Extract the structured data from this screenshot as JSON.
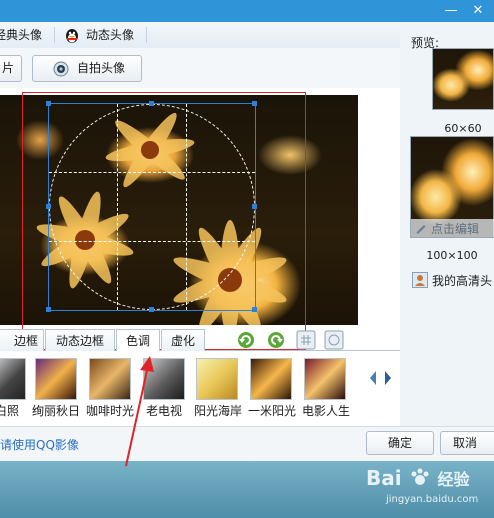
{
  "window": {
    "minimize": "—",
    "close": "✕"
  },
  "tabs": [
    {
      "label": "经典头像",
      "icon": "photo-icon"
    },
    {
      "label": "动态头像",
      "icon": "penguin-icon"
    }
  ],
  "toolbar": {
    "upload_label": "片",
    "selfie_label": "自拍头像"
  },
  "edit_tabs": [
    {
      "label": "边框"
    },
    {
      "label": "动态边框"
    },
    {
      "label": "色调",
      "active": true
    },
    {
      "label": "虚化"
    }
  ],
  "effects": [
    {
      "label": "白照",
      "tone": "gray"
    },
    {
      "label": "绚丽秋日",
      "tone": "autumn"
    },
    {
      "label": "咖啡时光",
      "tone": "coffee"
    },
    {
      "label": "老电视",
      "tone": "oldtv"
    },
    {
      "label": "阳光海岸",
      "tone": "sunny"
    },
    {
      "label": "一米阳光",
      "tone": "warm"
    },
    {
      "label": "电影人生",
      "tone": "film"
    }
  ],
  "preview": {
    "title": "预览:",
    "size_60": "60×60",
    "size_100": "100×100",
    "edit_overlay": "点击编辑",
    "hd_label": "我的高清头"
  },
  "bottom": {
    "link": "请使用QQ影像",
    "ok_label": "确定",
    "cancel_label": "取消"
  },
  "watermark": {
    "brand": "Bai",
    "brand_suffix": "经验",
    "url": "jingyan.baidu.com"
  },
  "colors": {
    "titlebar": "#2f95d8",
    "annotation_red": "#e0232a",
    "crop_blue": "#2e7fd6"
  }
}
